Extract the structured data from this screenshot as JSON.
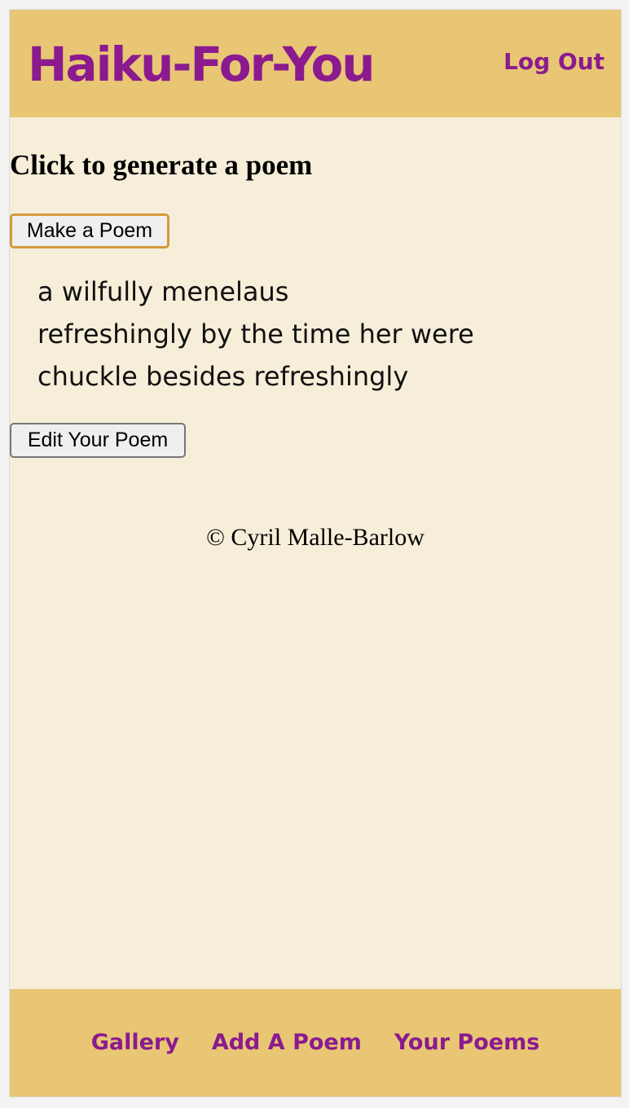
{
  "header": {
    "brand": "Haiku-For-You",
    "logout_label": "Log Out"
  },
  "main": {
    "heading": "Click to generate a poem",
    "make_poem_label": "Make a Poem",
    "poem_lines": [
      "a wilfully menelaus",
      "refreshingly by the time her were",
      "chuckle besides refreshingly"
    ],
    "edit_poem_label": "Edit Your Poem",
    "copyright": "© Cyril Malle-Barlow"
  },
  "footer": {
    "nav": [
      {
        "label": "Gallery"
      },
      {
        "label": "Add A Poem"
      },
      {
        "label": "Your Poems"
      }
    ]
  },
  "colors": {
    "header_bg": "#e8c674",
    "page_bg": "#f6eed9",
    "brand": "#8b1a8f",
    "focus_outline": "#d39a3b"
  }
}
